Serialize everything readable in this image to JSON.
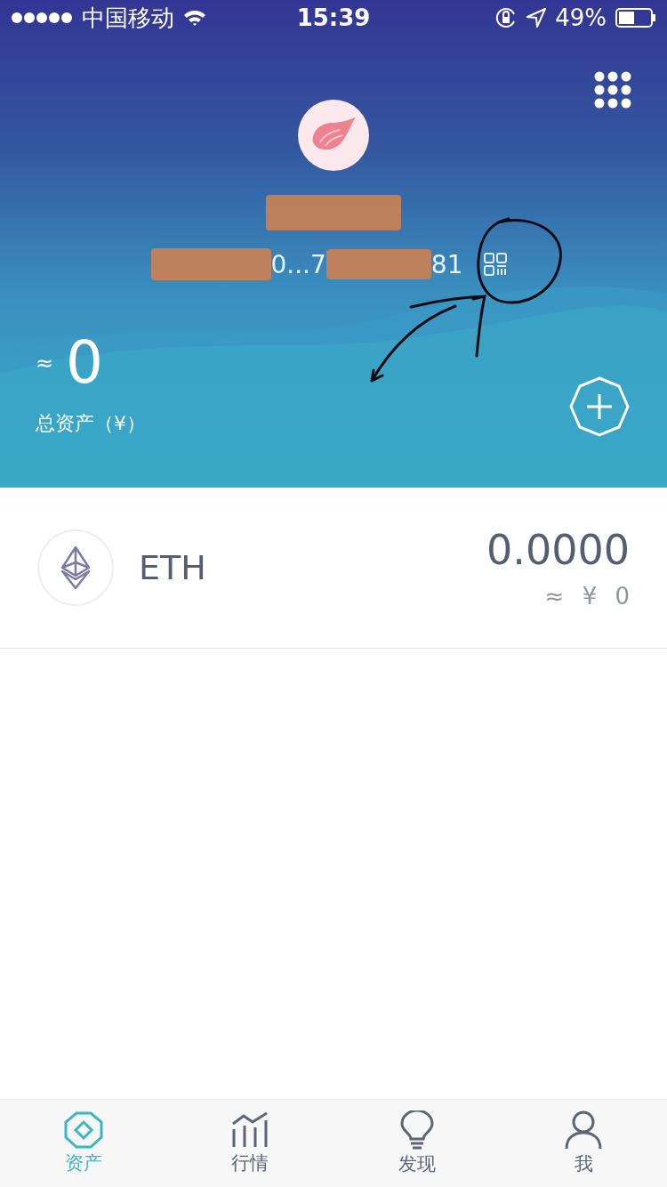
{
  "status_bar": {
    "carrier": "中国移动",
    "time": "15:39",
    "battery": "49%"
  },
  "wallet": {
    "address_parts": [
      "0...7",
      "81"
    ]
  },
  "total": {
    "approx": "≈",
    "amount": "0",
    "label": "总资产（¥）"
  },
  "assets": [
    {
      "symbol": "ETH",
      "balance": "0.0000",
      "fiat": "≈ ¥ 0"
    }
  ],
  "tabs": [
    {
      "label": "资产",
      "selected": true
    },
    {
      "label": "行情",
      "selected": false
    },
    {
      "label": "发现",
      "selected": false
    },
    {
      "label": "我",
      "selected": false
    }
  ]
}
